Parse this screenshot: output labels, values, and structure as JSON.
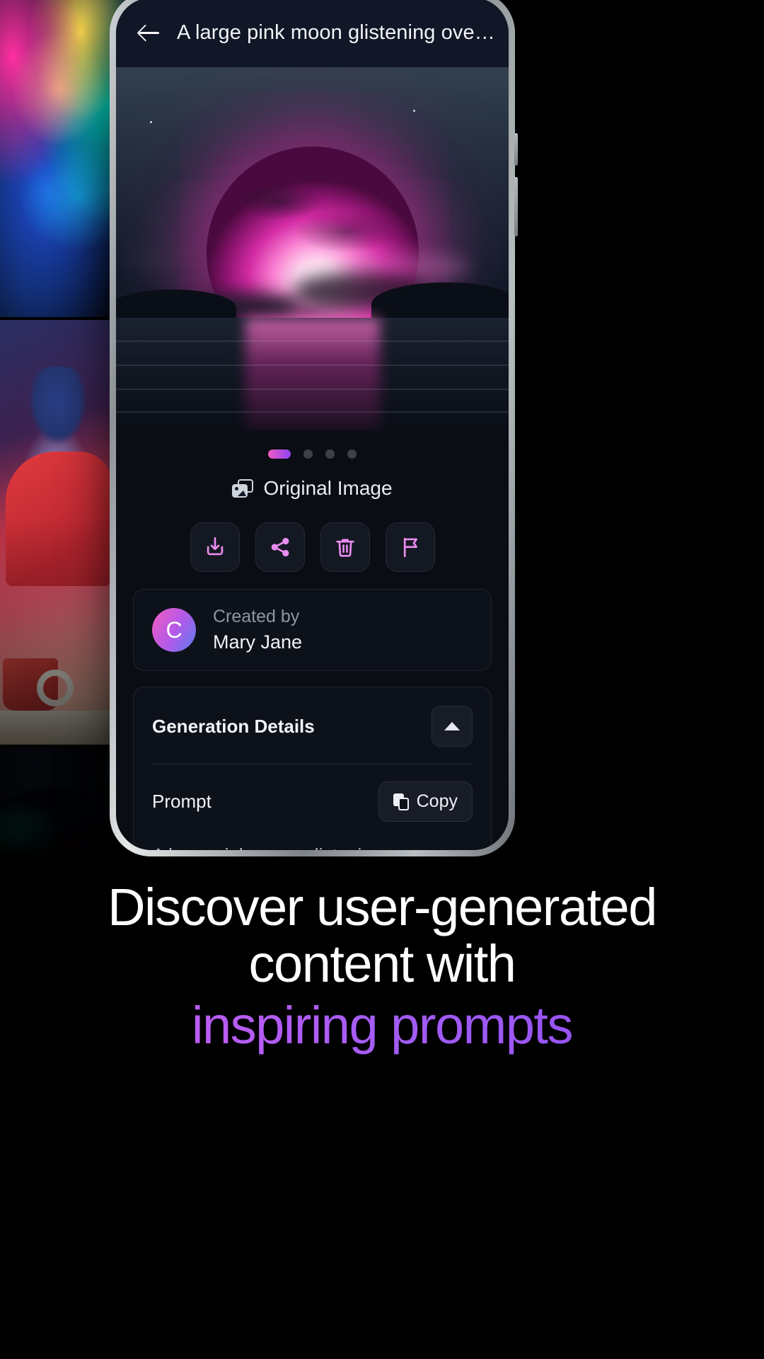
{
  "app": {
    "header": {
      "back_icon": "back-arrow-icon",
      "title": "A large pink moon glistening over a la..."
    },
    "hero": {
      "alt": "A large pink moon glistening over a lake"
    },
    "carousel": {
      "total": 4,
      "active_index": 0,
      "active_color": "#8b44f7",
      "inactive_color": "#3c4048"
    },
    "image_label": {
      "icon": "image-stack-icon",
      "text": "Original Image"
    },
    "actions": [
      {
        "name": "download",
        "icon": "download-icon",
        "color": "#e88cf0"
      },
      {
        "name": "share",
        "icon": "share-icon",
        "color": "#e88cf0"
      },
      {
        "name": "delete",
        "icon": "trash-icon",
        "color": "#e88cf0"
      },
      {
        "name": "report",
        "icon": "flag-icon",
        "color": "#e88cf0"
      }
    ],
    "creator": {
      "avatar_initial": "C",
      "label": "Created by",
      "name": "Mary Jane"
    },
    "generation_details": {
      "title": "Generation Details",
      "collapse_icon": "chevron-up-icon",
      "prompt_label": "Prompt",
      "copy_label": "Copy",
      "copy_icon": "copy-icon",
      "prompt_text": "A large pink moon glistening over a lake with luminous colours, grey clouds and a reflection in the water. Wide camera angle."
    }
  },
  "marketing": {
    "line1": "Discover user-generated",
    "line2": "content with",
    "line3": "inspiring prompts",
    "accent_color": "#a45cf5"
  }
}
